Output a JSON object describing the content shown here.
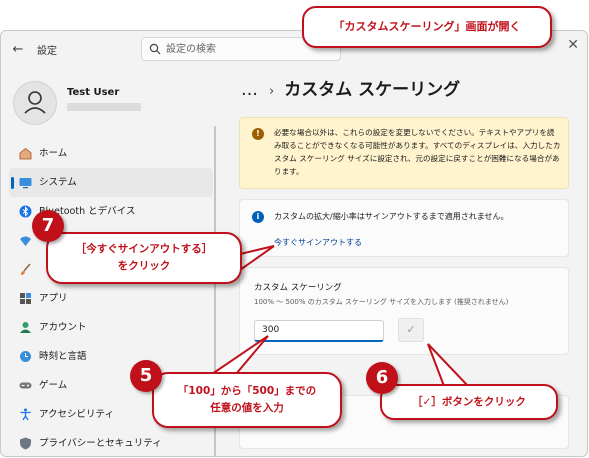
{
  "window": {
    "app_title": "設定",
    "back_icon": "back-arrow-icon",
    "close_icon": "close-icon",
    "search": {
      "placeholder": "設定の検索"
    }
  },
  "profile": {
    "name": "Test User"
  },
  "sidebar": {
    "items": [
      {
        "label": "ホーム",
        "icon": "home-icon",
        "active": false
      },
      {
        "label": "システム",
        "icon": "monitor-icon",
        "active": true
      },
      {
        "label": "Bluetooth とデバイス",
        "icon": "bluetooth-icon",
        "active": false
      },
      {
        "label": "",
        "icon": "network-icon",
        "active": false
      },
      {
        "label": "",
        "icon": "brush-icon",
        "active": false
      },
      {
        "label": "アプリ",
        "icon": "apps-icon",
        "active": false
      },
      {
        "label": "アカウント",
        "icon": "account-icon",
        "active": false
      },
      {
        "label": "時刻と言語",
        "icon": "globe-clock-icon",
        "active": false
      },
      {
        "label": "ゲーム",
        "icon": "gamepad-icon",
        "active": false
      },
      {
        "label": "アクセシビリティ",
        "icon": "accessibility-icon",
        "active": false
      },
      {
        "label": "プライバシーとセキュリティ",
        "icon": "shield-icon",
        "active": false
      }
    ]
  },
  "main": {
    "breadcrumb": {
      "dots": "…",
      "title": "カスタム スケーリング"
    },
    "warning": {
      "text": "必要な場合以外は、これらの設定を変更しないでください。テキストやアプリを読み取ることができなくなる可能性があります。すべてのディスプレイは、入力したカスタム スケーリング サイズに設定され、元の設定に戻すことが困難になる場合があります。"
    },
    "info": {
      "text": "カスタムの拡大/縮小率はサインアウトするまで適用されません。",
      "link": "今すぐサインアウトする"
    },
    "scaling": {
      "title": "カスタム スケーリング",
      "description": "100% ～ 500% のカスタム スケーリング サイズを入力します (推奨されません)",
      "value": "300",
      "confirm_icon": "checkmark-icon"
    }
  },
  "callouts": {
    "top": "「カスタムスケーリング」画面が開く",
    "step7": {
      "number": "7",
      "line1": "［今すぐサインアウトする］",
      "line2": "をクリック"
    },
    "step5": {
      "number": "5",
      "line1": "「100」から「500」までの",
      "line2": "任意の値を入力"
    },
    "step6": {
      "number": "6",
      "text": "［✓］ボタンをクリック"
    }
  },
  "colors": {
    "accent": "#0067c0",
    "callout": "#c0111b",
    "warning_bg": "#fff4ce"
  }
}
